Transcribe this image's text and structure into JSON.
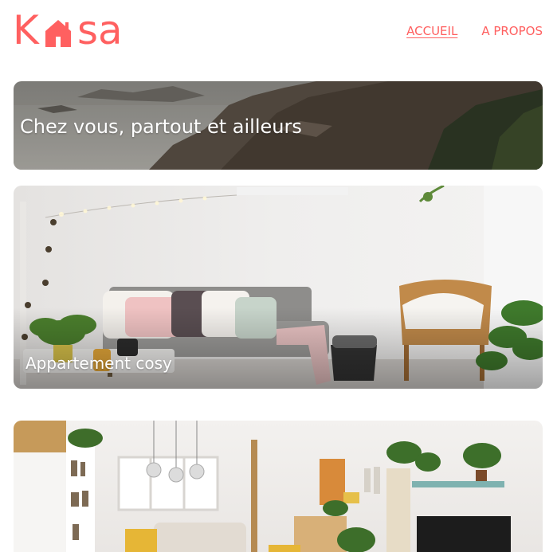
{
  "header": {
    "logo": {
      "text_left": "K",
      "text_right": "sa",
      "icon": "house-icon",
      "color": "#FF6060"
    },
    "nav": [
      {
        "label": "ACCUEIL",
        "active": true
      },
      {
        "label": "A PROPOS",
        "active": false
      }
    ]
  },
  "banner": {
    "caption": "Chez vous, partout et ailleurs",
    "image": "coastal-cliffs-photo"
  },
  "listings": [
    {
      "title": "Appartement cosy",
      "image": "living-room-sofa-photo"
    },
    {
      "title": "",
      "image": "open-living-room-photo"
    }
  ],
  "colors": {
    "accent": "#FF6060",
    "caption_text": "#FFFFFF"
  }
}
